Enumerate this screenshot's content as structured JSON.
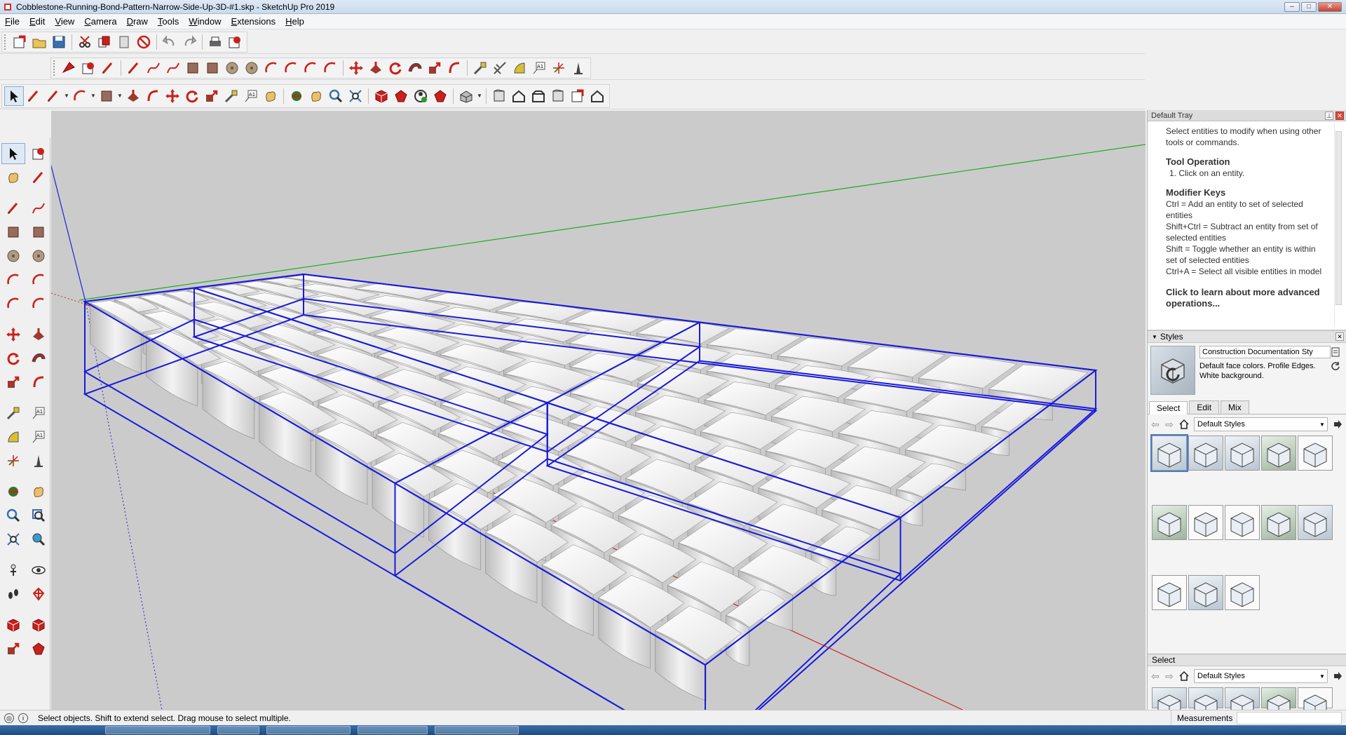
{
  "window": {
    "title": "Cobblestone-Running-Bond-Pattern-Narrow-Side-Up-3D-#1.skp - SketchUp Pro 2019",
    "buttons": {
      "minimize": "–",
      "maximize": "□",
      "close": "✕"
    }
  },
  "menu": [
    "File",
    "Edit",
    "View",
    "Camera",
    "Draw",
    "Tools",
    "Window",
    "Extensions",
    "Help"
  ],
  "toolbars": {
    "row1": [
      "new-3d-icon",
      "open-folder-icon",
      "save-icon",
      "cut-icon",
      "copy-icon",
      "paste-icon",
      "erase-icon",
      "undo-icon",
      "redo-icon",
      "print-icon",
      "model-info-icon"
    ],
    "row2": [
      "make-component-icon",
      "paint-bucket-icon",
      "eraser-icon",
      "pencil-icon",
      "line-icon",
      "freehand-icon",
      "rectangle-icon",
      "rotated-rectangle-icon",
      "circle-icon",
      "polygon-icon",
      "arc-icon",
      "arc-2pt-icon",
      "arc-3pt-icon",
      "pie-icon",
      "move-icon",
      "push-pull-icon",
      "rotate-icon",
      "follow-me-icon",
      "scale-icon",
      "offset-icon",
      "tape-measure-icon",
      "dimensions-icon",
      "protractor-icon",
      "text-icon",
      "axes-icon",
      "3d-text-icon"
    ],
    "row3": [
      "select-icon",
      "eraser-icon",
      "line-icon",
      "arc-icon",
      "rectangle-icon",
      "push-pull-icon",
      "offset-icon",
      "move-icon",
      "rotate-icon",
      "scale-icon",
      "tape-measure-icon",
      "text-icon",
      "paint-bucket-icon",
      "orbit-icon",
      "pan-icon",
      "zoom-icon",
      "zoom-extents-icon",
      "warehouse-icon",
      "extension-icon",
      "share-icon",
      "ruby-icon",
      "profile-icon",
      "iso-view-icon",
      "top-view-icon",
      "front-view-icon",
      "right-view-icon",
      "back-view-icon",
      "left-view-icon"
    ]
  },
  "tray": {
    "title": "Default Tray",
    "instructor": {
      "intro": "Select entities to modify when using other tools or commands.",
      "op_heading": "Tool Operation",
      "op_step": "1. Click on an entity.",
      "mod_heading": "Modifier Keys",
      "mod_lines": [
        "Ctrl = Add an entity to set of selected entities",
        "Shift+Ctrl = Subtract an entity from set of selected entities",
        "Shift = Toggle whether an entity is within set of selected entities",
        "Ctrl+A = Select all visible entities in model"
      ],
      "link": "Click to learn about more advanced operations..."
    },
    "styles": {
      "header": "Styles",
      "name": "Construction Documentation Sty",
      "description": "Default face colors. Profile Edges. White background.",
      "tabs": [
        "Select",
        "Edit",
        "Mix"
      ],
      "library": "Default Styles",
      "lower_header": "Select",
      "lower_library": "Default Styles"
    }
  },
  "status": {
    "message": "Select objects. Shift to extend select. Drag mouse to select multiple.",
    "measurements_label": "Measurements"
  },
  "colors": {
    "selection": "#1a1adb",
    "axis_red": "#cc2222",
    "axis_green": "#22aa22",
    "axis_blue": "#2222cc",
    "background": "#cbcbcb"
  }
}
